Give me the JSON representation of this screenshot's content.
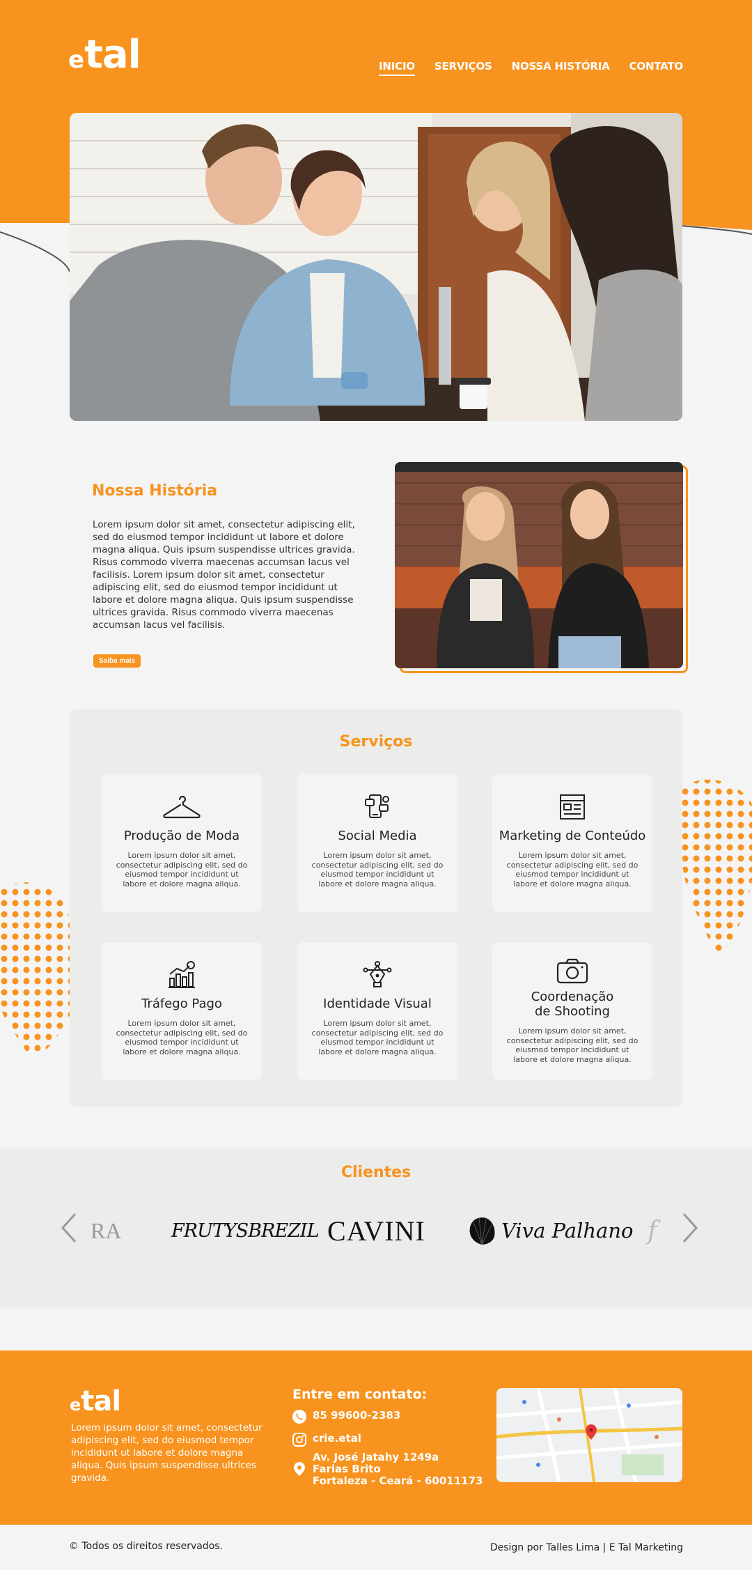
{
  "colors": {
    "brand_orange": "#f7931e",
    "panel_gray": "#ececea",
    "page_bg": "#f4f4f4"
  },
  "header": {
    "logo_e": "e",
    "logo_tal": "tal",
    "nav": [
      {
        "label": "INICIO",
        "active": true
      },
      {
        "label": "SERVIÇOS",
        "active": false
      },
      {
        "label": "NOSSA HISTÓRIA",
        "active": false
      },
      {
        "label": "CONTATO",
        "active": false
      }
    ]
  },
  "historia": {
    "title": "Nossa História",
    "text": "Lorem ipsum dolor sit amet, consectetur adipiscing elit, sed do eiusmod tempor incididunt ut labore et dolore magna aliqua. Quis ipsum suspendisse ultrices gravida. Risus commodo viverra maecenas accumsan lacus vel facilisis. Lorem ipsum dolor sit amet, consectetur adipiscing elit, sed do eiusmod tempor incididunt ut labore et dolore magna aliqua. Quis ipsum suspendisse ultrices gravida. Risus commodo viverra maecenas accumsan lacus vel facilisis.",
    "button": "Saiba mais"
  },
  "servicos": {
    "title": "Serviços",
    "items": [
      {
        "title": "Produção de Moda",
        "icon": "hanger-icon",
        "desc": "Lorem ipsum dolor sit amet, consectetur adipiscing elit, sed do eiusmod tempor incididunt ut labore et dolore magna aliqua."
      },
      {
        "title": "Social Media",
        "icon": "social-media-icon",
        "desc": "Lorem ipsum dolor sit amet, consectetur adipiscing elit, sed do eiusmod tempor incididunt ut labore et dolore magna aliqua."
      },
      {
        "title": "Marketing de Conteúdo",
        "icon": "content-layout-icon",
        "desc": "Lorem ipsum dolor sit amet, consectetur adipiscing elit, sed do eiusmod tempor incididunt ut labore et dolore magna aliqua."
      },
      {
        "title": "Tráfego Pago",
        "icon": "growth-chart-icon",
        "desc": "Lorem ipsum dolor sit amet, consectetur adipiscing elit, sed do eiusmod tempor incididunt ut labore et dolore magna aliqua."
      },
      {
        "title": "Identidade Visual",
        "icon": "pen-tool-icon",
        "desc": "Lorem ipsum dolor sit amet, consectetur adipiscing elit, sed do eiusmod tempor incididunt ut labore et dolore magna aliqua."
      },
      {
        "title_line1": "Coordenação",
        "title_line2": "de Shooting",
        "icon": "camera-icon",
        "desc": "Lorem ipsum dolor sit amet, consectetur adipiscing elit, sed do eiusmod tempor incididunt ut labore et dolore magna aliqua."
      }
    ]
  },
  "clientes": {
    "title": "Clientes",
    "logos": [
      {
        "text": "RA"
      },
      {
        "text": "FRUTYSBREZIL"
      },
      {
        "text": "CAVINI"
      },
      {
        "text": "Viva Palhano"
      },
      {
        "text": "f"
      }
    ]
  },
  "footer": {
    "logo_e": "e",
    "logo_tal": "tal",
    "desc": "Lorem ipsum dolor sit amet, consectetur adipiscing elit, sed do eiusmod tempor incididunt ut labore et dolore magna aliqua. Quis ipsum suspendisse ultrices gravida.",
    "contact_title": "Entre em contato:",
    "phone": "85 99600-2383",
    "instagram": "crie.etal",
    "address_line1": "Av. José Jatahy 1249a",
    "address_line2": "Farias Brito",
    "address_line3": "Fortaleza - Ceará - 60011173"
  },
  "bottom": {
    "copyright": "© Todos os direitos reservados.",
    "credit": "Design por Talles Lima | E Tal Marketing"
  }
}
